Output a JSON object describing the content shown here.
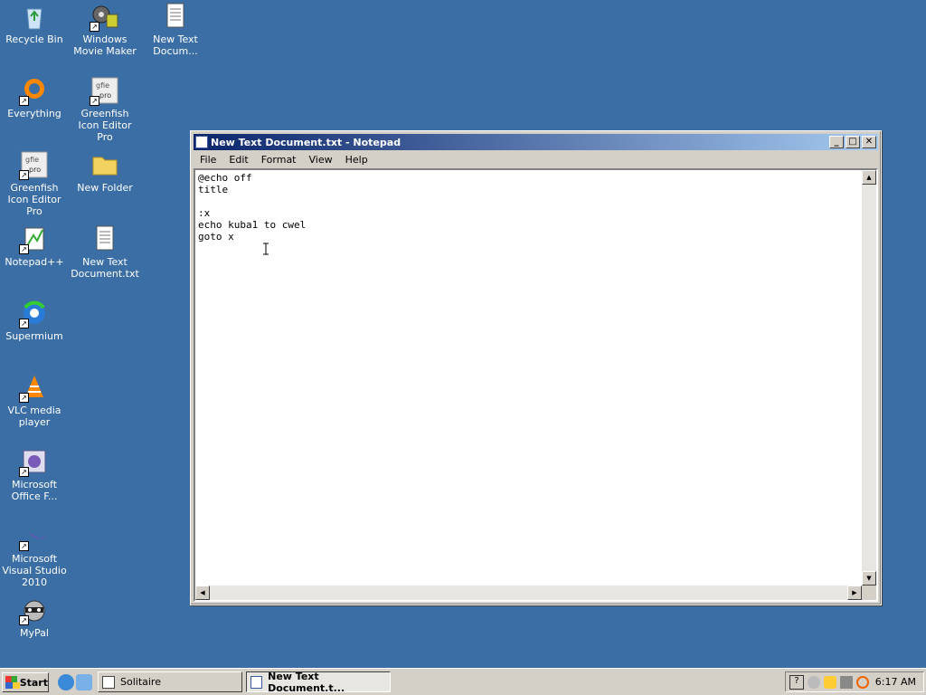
{
  "desktop": {
    "icons": [
      {
        "label": "Recycle Bin"
      },
      {
        "label": "Windows Movie Maker"
      },
      {
        "label": "New Text Docum..."
      },
      {
        "label": "Everything"
      },
      {
        "label": "Greenfish Icon Editor Pro"
      },
      {
        "label": "Greenfish Icon Editor Pro"
      },
      {
        "label": "New Folder"
      },
      {
        "label": "Notepad++"
      },
      {
        "label": "New Text Document.txt"
      },
      {
        "label": "Supermium"
      },
      {
        "label": "VLC media player"
      },
      {
        "label": "Microsoft Office F..."
      },
      {
        "label": "Microsoft Visual Studio 2010"
      },
      {
        "label": "MyPal"
      }
    ]
  },
  "window": {
    "title": "New Text Document.txt - Notepad",
    "menu": [
      "File",
      "Edit",
      "Format",
      "View",
      "Help"
    ],
    "content": "@echo off\ntitle \n\n:x\necho kuba1 to cwel\ngoto x"
  },
  "taskbar": {
    "start_label": "Start",
    "tasks": [
      {
        "label": "Solitaire"
      },
      {
        "label": "New Text Document.t..."
      }
    ],
    "clock": "6:17 AM"
  },
  "colors": {
    "desktop": "#3a6ea5",
    "title_start": "#0a246a",
    "title_end": "#a6caf0"
  }
}
